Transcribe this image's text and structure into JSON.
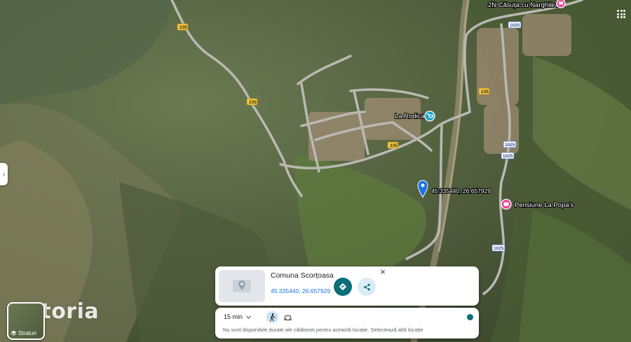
{
  "map": {
    "places": [
      {
        "name": "2N Căsuța cu Narghilea",
        "kind": "lodging"
      },
      {
        "name": "La Rodica",
        "kind": "shop"
      },
      {
        "name": "Pensiune La Popa's",
        "kind": "lodging"
      }
    ],
    "pin_coords_label": "45.335440, 26.657929",
    "road_badges": {
      "r1": "235",
      "r2": "235",
      "r3": "235",
      "r4": "235",
      "b1": "1025",
      "b2": "1025",
      "b3": "1025",
      "b4": "1025"
    }
  },
  "watermark": "storia",
  "layers_button": {
    "label": "Straturi",
    "icon": "layers-icon"
  },
  "info_card": {
    "title": "Comuna Scorțoasa",
    "coordinates": "45.335440, 26.657929",
    "close_label": "×",
    "directions_icon": "directions-icon",
    "share_icon": "share-icon"
  },
  "travel_panel": {
    "duration": "15 min",
    "message": "Nu sunt disponibile durate ale călătoriei pentru această locație. Selectează altă locație"
  },
  "colors": {
    "accent": "#0b6e78",
    "link": "#1a73e8",
    "lodging_marker": "#e8479a",
    "shop_marker": "#1aa3c9",
    "pin": "#1a73e8"
  }
}
